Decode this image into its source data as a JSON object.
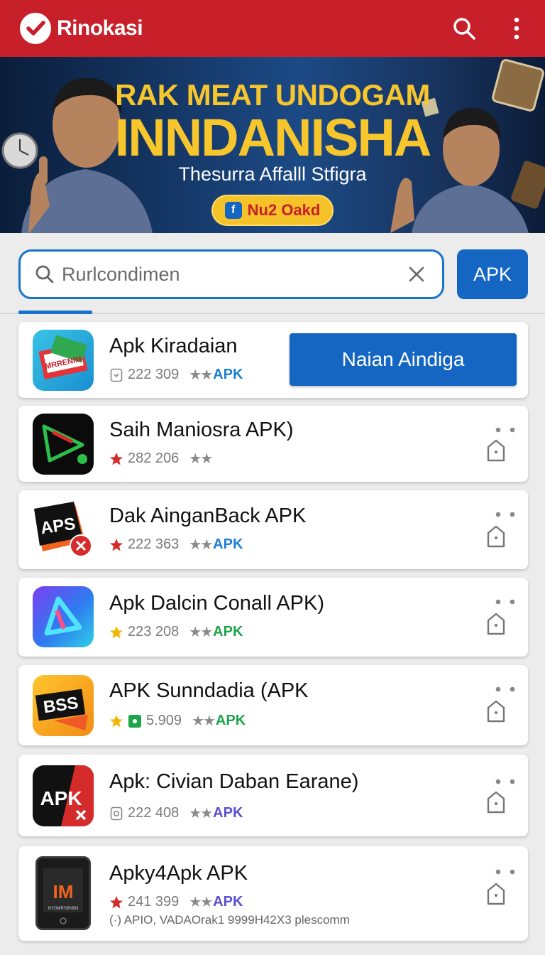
{
  "app": {
    "title": "Rinokasi"
  },
  "colors": {
    "primary_red": "#c8202b",
    "accent_blue": "#1466c2",
    "banner_yellow": "#f7c52c",
    "star_red": "#d62b2b",
    "star_yellow": "#f2b705",
    "tag_blue": "#1a7fd4",
    "tag_green": "#1ea44a",
    "tag_purple": "#5b4fd0"
  },
  "appbar": {
    "icons": [
      "search-icon",
      "more-vert-icon"
    ]
  },
  "banner": {
    "line1": "RAK MEAT UNDOGAM",
    "line2": "INNDANISHA",
    "subtitle": "Thesurra Affalll Stfigra",
    "button_label": "Nu2 Oakd",
    "button_icon": "f"
  },
  "search": {
    "placeholder": "Rurlcondimen",
    "button_label": "APK"
  },
  "apps": [
    {
      "name": "Apk Kiradaian",
      "badge": "shield-icon",
      "count": "222 309",
      "stars": "★★",
      "tag": "APK",
      "tag_color": "#1a7fd4",
      "icon_text": "MRRENIM",
      "action_label": "Naian Aindiga"
    },
    {
      "name": "Saih Maniosra APK)",
      "badge": "star-icon",
      "badge_color": "#d62b2b",
      "count": "282 206",
      "stars": "★★",
      "tag": "",
      "tag_color": "#1a7fd4",
      "icon_text": ""
    },
    {
      "name": "Dak AinganBack APK",
      "badge": "star-icon",
      "badge_color": "#d62b2b",
      "count": "222 363",
      "stars": "★★",
      "tag": "APK",
      "tag_color": "#1a7fd4",
      "icon_text": "APS"
    },
    {
      "name": "Apk Dalcin Conall APK)",
      "badge": "star-icon",
      "badge_color": "#f2b705",
      "count": "223 208",
      "stars": "★★",
      "tag": "APK",
      "tag_color": "#1ea44a",
      "icon_text": ""
    },
    {
      "name": "APK Sunndadia (APK",
      "badge": "star-icon",
      "badge_color": "#f2b705",
      "count": "5.909",
      "stars": "★★",
      "tag": "APK",
      "tag_color": "#1ea44a",
      "icon_text": "BSS"
    },
    {
      "name": "Apk: Civian Daban Earane)",
      "badge": "shield-icon",
      "count": "222 408",
      "stars": "★★",
      "tag": "APK",
      "tag_color": "#5b4fd0",
      "icon_text": "APK"
    },
    {
      "name": "Apky4Apk APK",
      "badge": "star-icon",
      "badge_color": "#d62b2b",
      "count": "241 399",
      "stars": "★★",
      "tag": "APK",
      "tag_color": "#5b4fd0",
      "icon_text": "IM",
      "icon_subtext": "NYOMRSBNBN",
      "extra": "(·) APIO, VADAOrak1 9999H42X3 plescomm"
    }
  ]
}
